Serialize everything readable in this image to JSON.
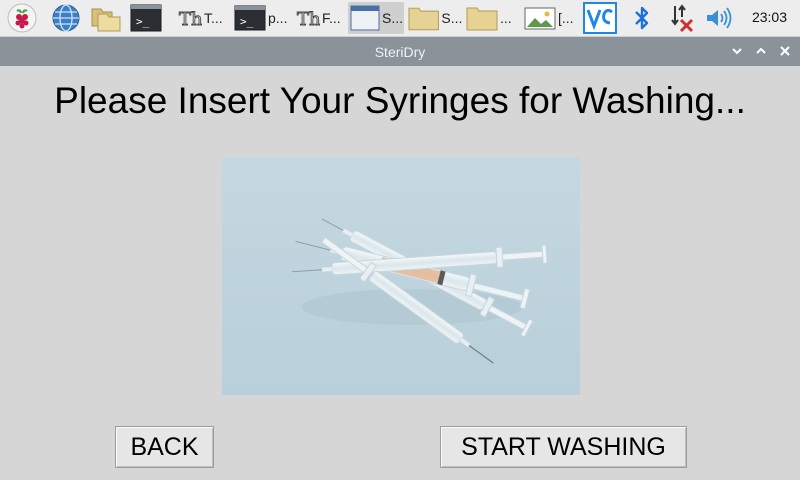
{
  "taskbar": {
    "items": [
      {
        "icon": "raspberry-pi-icon"
      },
      {
        "icon": "web-browser-icon"
      },
      {
        "icon": "file-manager-icon"
      },
      {
        "icon": "terminal-icon"
      },
      {
        "icon": "text-editor-icon",
        "label": "T..."
      },
      {
        "icon": "terminal-icon",
        "label": "p..."
      },
      {
        "icon": "text-editor-icon",
        "label": "F..."
      },
      {
        "icon": "app-window-icon",
        "label": "S..."
      },
      {
        "icon": "folder-icon",
        "label": "S..."
      },
      {
        "icon": "folder-icon",
        "label": "..."
      },
      {
        "icon": "image-viewer-icon",
        "label": "[..."
      }
    ],
    "tray": [
      "vnc-icon",
      "bluetooth-icon",
      "network-disconnected-icon",
      "volume-icon"
    ],
    "clock": "23:03"
  },
  "window": {
    "title": "SteriDry",
    "controls": [
      "minimize",
      "maximize",
      "close"
    ]
  },
  "main": {
    "heading": "Please Insert Your Syringes for Washing...",
    "image_subject": "syringes-photo",
    "back_label": "BACK",
    "start_label": "START WASHING"
  },
  "colors": {
    "window_bg": "#d6d6d6",
    "titlebar_bg": "#8a9399",
    "photo_bg": "#c3d7e0",
    "button_bg": "#e6e6e6"
  }
}
